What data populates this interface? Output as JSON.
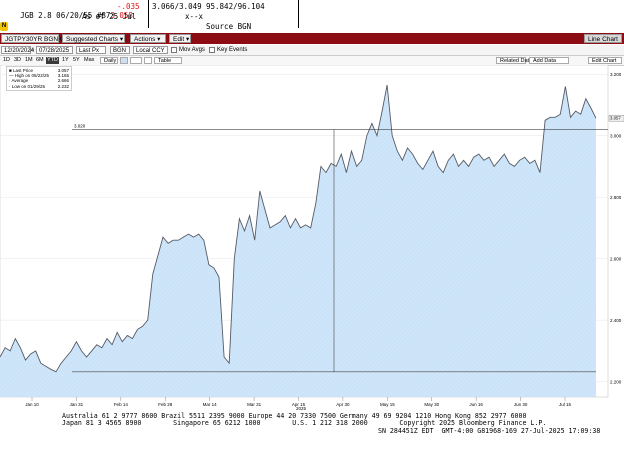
{
  "header": {
    "line1": "JGB 2.8 06/20/55 #87",
    "price": "3.058",
    "change": "-.035",
    "bidask": "3.066/3.049",
    "prices": "95.842/96.104",
    "asof": "As of 25 Jul",
    "xx": "x--x",
    "source": "Source BGN",
    "badge": "N"
  },
  "toolbar": {
    "ticker": "JGTPY30YR BGN C",
    "suggested": "Suggested Charts",
    "actions": "Actions",
    "edit": "Edit",
    "line_chart": "Line Chart"
  },
  "controls": {
    "start_date": "12/20/2024",
    "end_date": "07/28/2025",
    "last_px": "Last Px",
    "bgn": "BGN",
    "local_ccy": "Local CCY",
    "mov_avgs": "Mov Avgs",
    "key_events": "Key Events"
  },
  "periods": {
    "items": [
      "1D",
      "3D",
      "1M",
      "6M",
      "YTD",
      "1Y",
      "5Y",
      "Max"
    ],
    "selected": "YTD",
    "freq": "Daily",
    "table": "Table",
    "related_data": "Related Data",
    "add_data": "Add Data",
    "edit_chart": "Edit Chart"
  },
  "legend": {
    "items": [
      {
        "label": "Last Price",
        "value": "3.057"
      },
      {
        "label": "High on 05/22/25",
        "value": "3.165"
      },
      {
        "label": "Average",
        "value": "2.666"
      },
      {
        "label": "Low on 01/29/25",
        "value": "2.232"
      }
    ]
  },
  "chart_data": {
    "type": "area",
    "y_ticks": [
      "3.200",
      "3.000",
      "2.800",
      "2.600",
      "2.400",
      "2.200"
    ],
    "ylim": [
      2.15,
      3.23
    ],
    "x_ticks": [
      "Jan 10",
      "Jan 31",
      "Feb 14",
      "Feb 28",
      "Mar 14",
      "Mar 31",
      "Apr 15",
      "Apr 30",
      "May 15",
      "May 30",
      "Jun 16",
      "Jun 30",
      "Jul 15"
    ],
    "x_year": "2025",
    "hline_label": "3.020",
    "last_label": "3.057",
    "values": [
      2.28,
      2.31,
      2.3,
      2.34,
      2.31,
      2.27,
      2.29,
      2.3,
      2.26,
      2.25,
      2.24,
      2.232,
      2.26,
      2.28,
      2.3,
      2.33,
      2.3,
      2.28,
      2.3,
      2.32,
      2.31,
      2.34,
      2.32,
      2.36,
      2.33,
      2.35,
      2.34,
      2.37,
      2.38,
      2.4,
      2.55,
      2.61,
      2.67,
      2.65,
      2.66,
      2.66,
      2.67,
      2.68,
      2.67,
      2.68,
      2.66,
      2.58,
      2.57,
      2.54,
      2.28,
      2.26,
      2.6,
      2.73,
      2.69,
      2.74,
      2.66,
      2.82,
      2.76,
      2.7,
      2.71,
      2.72,
      2.74,
      2.7,
      2.73,
      2.7,
      2.71,
      2.7,
      2.78,
      2.9,
      2.88,
      2.91,
      2.9,
      2.94,
      2.88,
      2.95,
      2.9,
      2.92,
      3.0,
      3.04,
      3.0,
      3.08,
      3.165,
      3.0,
      2.95,
      2.92,
      2.96,
      2.94,
      2.91,
      2.89,
      2.92,
      2.95,
      2.9,
      2.88,
      2.92,
      2.94,
      2.9,
      2.92,
      2.9,
      2.93,
      2.94,
      2.92,
      2.93,
      2.9,
      2.92,
      2.94,
      2.91,
      2.9,
      2.92,
      2.93,
      2.91,
      2.92,
      2.88,
      3.05,
      3.06,
      3.06,
      3.07,
      3.16,
      3.06,
      3.08,
      3.07,
      3.12,
      3.09,
      3.057
    ]
  },
  "footer": {
    "line1": "Australia 61 2 9777 8600 Brazil 5511 2395 9000 Europe 44 20 7330 7500 Germany 49 69 9204 1210 Hong Kong 852 2977 6000",
    "line2": "Japan 81 3 4565 8900        Singapore 65 6212 1000        U.S. 1 212 318 2000        Copyright 2025 Bloomberg Finance L.P.",
    "line3": "SN 284451Z EDT  GMT-4:00 G81968-169 27-Jul-2025 17:09:38"
  }
}
